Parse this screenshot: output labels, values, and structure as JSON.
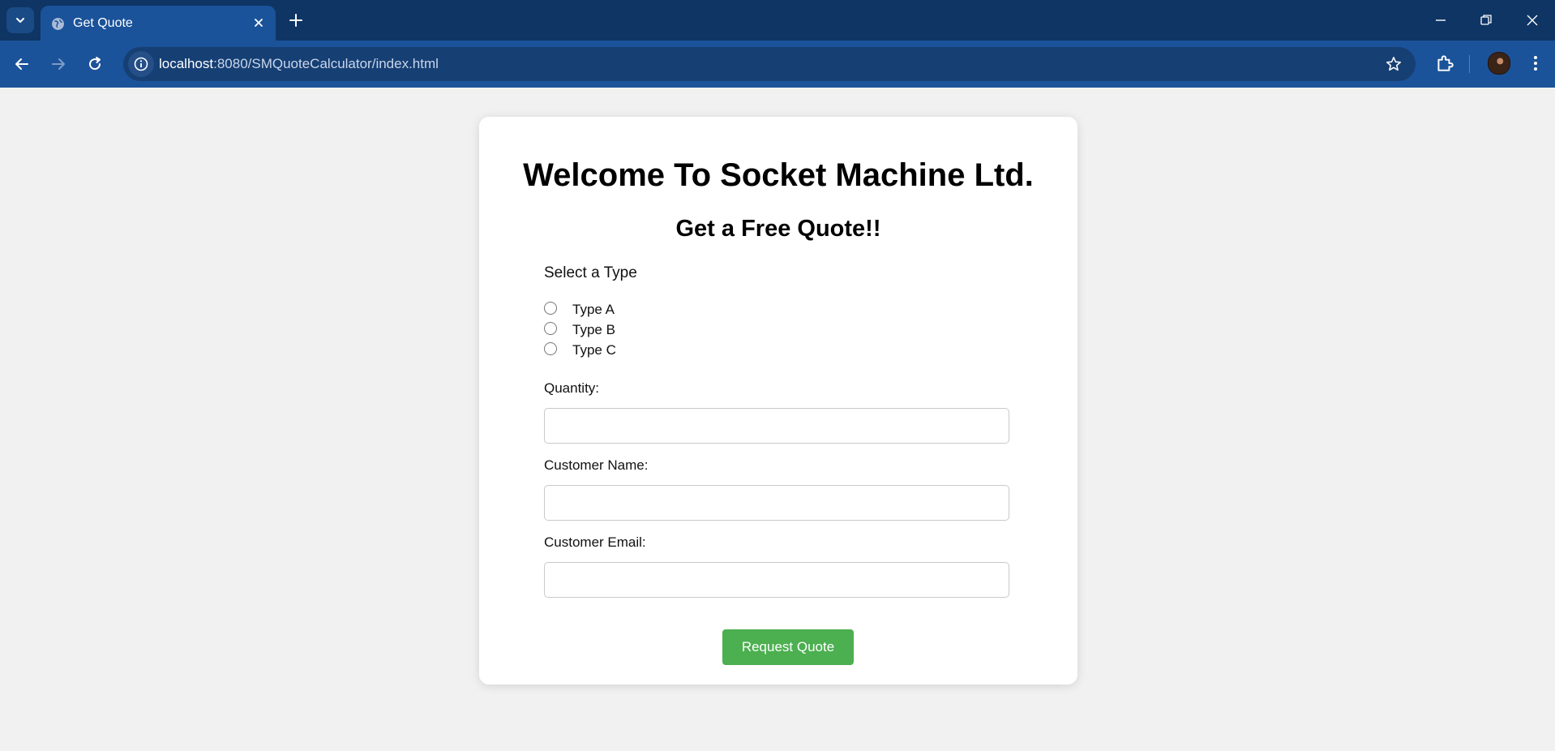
{
  "browser": {
    "tab_title": "Get Quote",
    "url_host": "localhost",
    "url_rest": ":8080/SMQuoteCalculator/index.html"
  },
  "page": {
    "heading": "Welcome To Socket Machine Ltd.",
    "subheading": "Get a Free Quote!!",
    "type_label": "Select a Type",
    "types": [
      "Type A",
      "Type B",
      "Type C"
    ],
    "quantity_label": "Quantity:",
    "quantity_value": "",
    "name_label": "Customer Name:",
    "name_value": "",
    "email_label": "Customer Email:",
    "email_value": "",
    "submit_label": "Request Quote"
  },
  "colors": {
    "tabbar": "#0e3564",
    "toolbar": "#1b539a",
    "page_bg": "#f1f1f1",
    "button": "#4caf50"
  }
}
